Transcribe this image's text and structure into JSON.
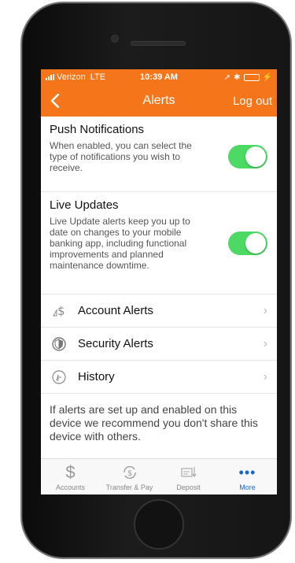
{
  "status_bar": {
    "carrier": "Verizon",
    "network": "LTE",
    "time": "10:39 AM"
  },
  "nav": {
    "title": "Alerts",
    "logout_label": "Log out"
  },
  "settings": [
    {
      "title": "Push Notifications",
      "description": "When enabled, you can select the type of notifications you wish to receive.",
      "enabled": true
    },
    {
      "title": "Live Updates",
      "description": "Live Update alerts keep you up to date on changes to your mobile banking app, including functional improvements and planned maintenance downtime.",
      "enabled": true
    }
  ],
  "menu": [
    {
      "label": "Account Alerts",
      "icon": "dollar-bell-icon"
    },
    {
      "label": "Security Alerts",
      "icon": "shield-icon"
    },
    {
      "label": "History",
      "icon": "clock-bell-icon"
    }
  ],
  "note": "If alerts are set up and enabled on this device we recommend you don't share this device with others.",
  "tabs": [
    {
      "label": "Accounts",
      "icon": "dollar-icon",
      "active": false
    },
    {
      "label": "Transfer & Pay",
      "icon": "transfer-icon",
      "active": false
    },
    {
      "label": "Deposit",
      "icon": "deposit-check-icon",
      "active": false
    },
    {
      "label": "More",
      "icon": "more-dots-icon",
      "active": true
    }
  ],
  "colors": {
    "brand_orange": "#f5761a",
    "toggle_on": "#4cd964",
    "active_tab": "#1a66c8"
  }
}
